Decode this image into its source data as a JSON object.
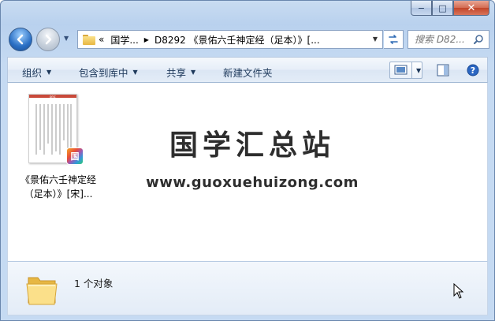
{
  "window": {
    "minimize": "−",
    "maximize": "□",
    "close": "✕"
  },
  "address_bar": {
    "overflow": "«",
    "crumbs": [
      "国学...",
      "D8292 《景佑六壬神定经（足本）》[..."
    ]
  },
  "search": {
    "placeholder": "搜索 D82..."
  },
  "toolbar": {
    "organize": "组织",
    "include_in_library": "包含到库中",
    "share": "共享",
    "new_folder": "新建文件夹"
  },
  "files": [
    {
      "name_line1": "《景佑六壬神定经",
      "name_line2": "（足本）》[宋]...",
      "badge": "国",
      "thumb_tag": "PDF"
    }
  ],
  "watermark": {
    "title": "国学汇总站",
    "url": "www.guoxuehuizong.com"
  },
  "details": {
    "count": "1 个对象"
  },
  "colors": {
    "accent": "#1e395b",
    "window_frame": "#b9d1ee",
    "close_red": "#c24529"
  }
}
